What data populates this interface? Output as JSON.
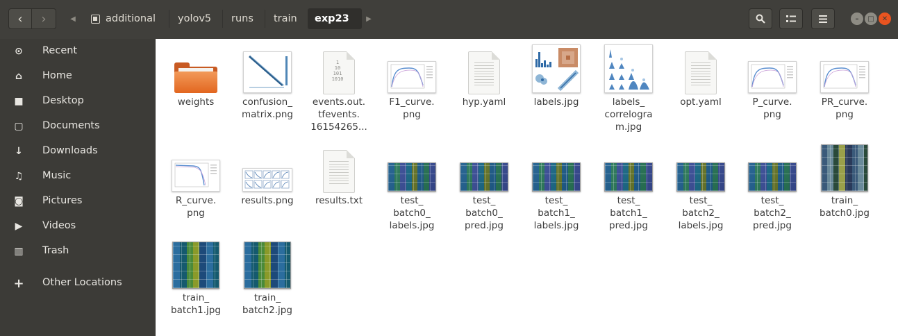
{
  "header": {
    "back_icon": "chevron-left-icon",
    "forward_icon": "chevron-right-icon",
    "back_glyph": "‹",
    "forward_glyph": "›",
    "path": [
      {
        "label": "additional"
      },
      {
        "label": "yolov5"
      },
      {
        "label": "runs"
      },
      {
        "label": "train"
      },
      {
        "label": "exp23"
      }
    ],
    "tools": {
      "search_icon": "search-icon",
      "view_icon": "view-toggle-icon",
      "menu_icon": "hamburger-menu-icon"
    }
  },
  "sidebar": {
    "items": [
      {
        "label": "Recent",
        "icon": "clock-icon",
        "glyph": "⊙"
      },
      {
        "label": "Home",
        "icon": "home-icon",
        "glyph": "⌂"
      },
      {
        "label": "Desktop",
        "icon": "folder-icon",
        "glyph": "■"
      },
      {
        "label": "Documents",
        "icon": "document-icon",
        "glyph": "▢"
      },
      {
        "label": "Downloads",
        "icon": "download-icon",
        "glyph": "↓"
      },
      {
        "label": "Music",
        "icon": "music-icon",
        "glyph": "♫"
      },
      {
        "label": "Pictures",
        "icon": "camera-icon",
        "glyph": "◙"
      },
      {
        "label": "Videos",
        "icon": "video-icon",
        "glyph": "▶"
      },
      {
        "label": "Trash",
        "icon": "trash-icon",
        "glyph": "▥"
      },
      {
        "label": "Other Locations",
        "icon": "plus-icon",
        "glyph": "+"
      }
    ]
  },
  "files": [
    {
      "name_lines": [
        "weights"
      ],
      "kind": "folder"
    },
    {
      "name_lines": [
        "confusion_",
        "matrix.png"
      ],
      "kind": "confusion"
    },
    {
      "name_lines": [
        "events.out.",
        "tfevents.",
        "16154265..."
      ],
      "kind": "binary",
      "bin_text": "1\n10\n101\n1010"
    },
    {
      "name_lines": [
        "F1_curve.",
        "png"
      ],
      "kind": "curve"
    },
    {
      "name_lines": [
        "hyp.yaml"
      ],
      "kind": "text"
    },
    {
      "name_lines": [
        "labels.jpg"
      ],
      "kind": "labels"
    },
    {
      "name_lines": [
        "labels_",
        "correlogra",
        "m.jpg"
      ],
      "kind": "correlogram"
    },
    {
      "name_lines": [
        "opt.yaml"
      ],
      "kind": "text"
    },
    {
      "name_lines": [
        "P_curve.",
        "png"
      ],
      "kind": "curve"
    },
    {
      "name_lines": [
        "PR_curve.",
        "png"
      ],
      "kind": "curve"
    },
    {
      "name_lines": [
        "R_curve.",
        "png"
      ],
      "kind": "rcurve"
    },
    {
      "name_lines": [
        "results.png"
      ],
      "kind": "results"
    },
    {
      "name_lines": [
        "results.txt"
      ],
      "kind": "text"
    },
    {
      "name_lines": [
        "test_",
        "batch0_",
        "labels.jpg"
      ],
      "kind": "photo"
    },
    {
      "name_lines": [
        "test_",
        "batch0_",
        "pred.jpg"
      ],
      "kind": "photo"
    },
    {
      "name_lines": [
        "test_",
        "batch1_",
        "labels.jpg"
      ],
      "kind": "photo"
    },
    {
      "name_lines": [
        "test_",
        "batch1_",
        "pred.jpg"
      ],
      "kind": "photo"
    },
    {
      "name_lines": [
        "test_",
        "batch2_",
        "labels.jpg"
      ],
      "kind": "photo"
    },
    {
      "name_lines": [
        "test_",
        "batch2_",
        "pred.jpg"
      ],
      "kind": "photo"
    },
    {
      "name_lines": [
        "train_",
        "batch0.jpg"
      ],
      "kind": "photo_sq"
    },
    {
      "name_lines": [
        "train_",
        "batch1.jpg"
      ],
      "kind": "photo_sq"
    },
    {
      "name_lines": [
        "train_",
        "batch2.jpg"
      ],
      "kind": "photo_sq"
    }
  ]
}
